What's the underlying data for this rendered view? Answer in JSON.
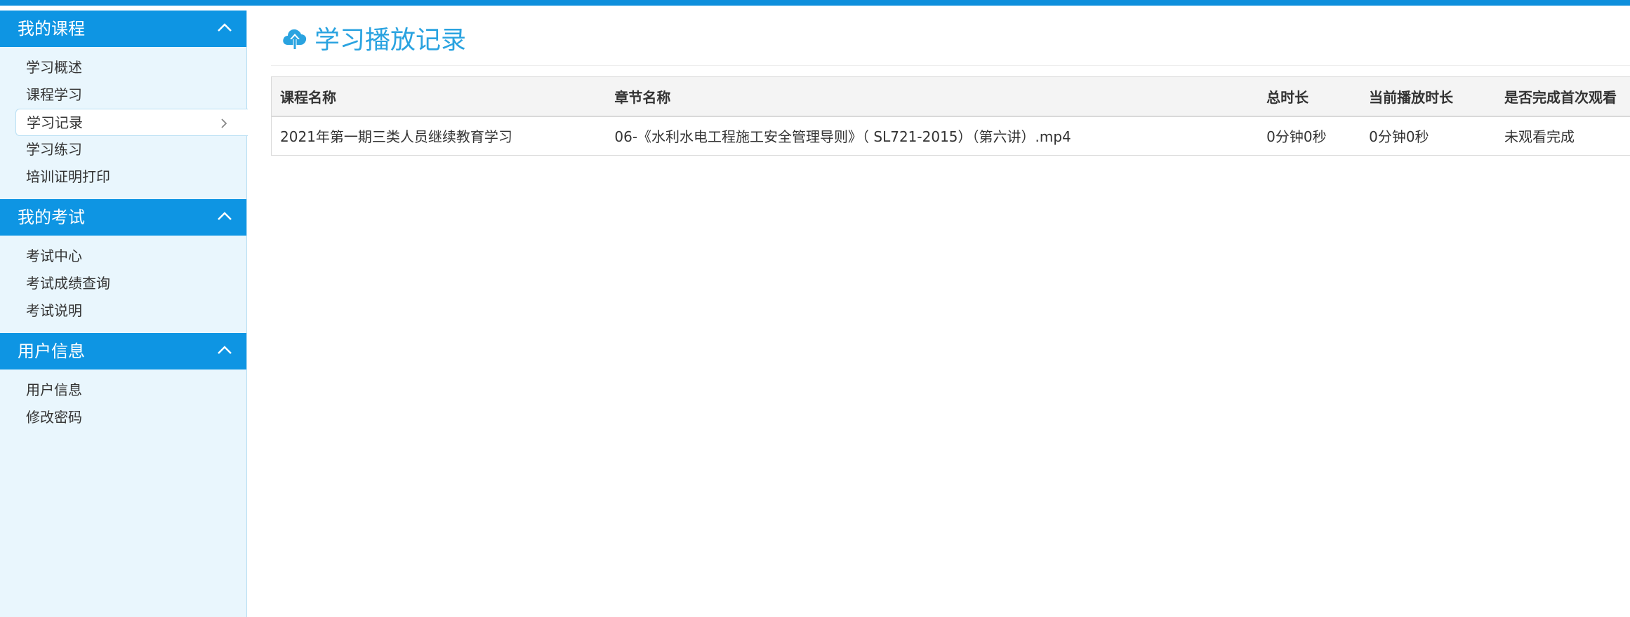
{
  "sidebar": {
    "sections": [
      {
        "title": "我的课程",
        "items": [
          {
            "label": "学习概述"
          },
          {
            "label": "课程学习"
          },
          {
            "label": "学习记录",
            "active": true
          },
          {
            "label": "学习练习"
          },
          {
            "label": "培训证明打印"
          }
        ]
      },
      {
        "title": "我的考试",
        "items": [
          {
            "label": "考试中心"
          },
          {
            "label": "考试成绩查询"
          },
          {
            "label": "考试说明"
          }
        ]
      },
      {
        "title": "用户信息",
        "items": [
          {
            "label": "用户信息"
          },
          {
            "label": "修改密码"
          }
        ]
      }
    ]
  },
  "page": {
    "title": "学习播放记录",
    "title_icon": "cloud-upload-icon"
  },
  "table": {
    "columns": [
      "课程名称",
      "章节名称",
      "总时长",
      "当前播放时长",
      "是否完成首次观看"
    ],
    "rows": [
      [
        "2021年第一期三类人员继续教育学习",
        "06-《水利水电工程施工安全管理导则》（ SL721-2015）（第六讲）.mp4",
        "0分钟0秒",
        "0分钟0秒",
        "未观看完成"
      ]
    ]
  },
  "colors": {
    "accent": "#0e95e3",
    "title": "#2aa3e0",
    "sidebar_bg": "#e9f6fd"
  }
}
